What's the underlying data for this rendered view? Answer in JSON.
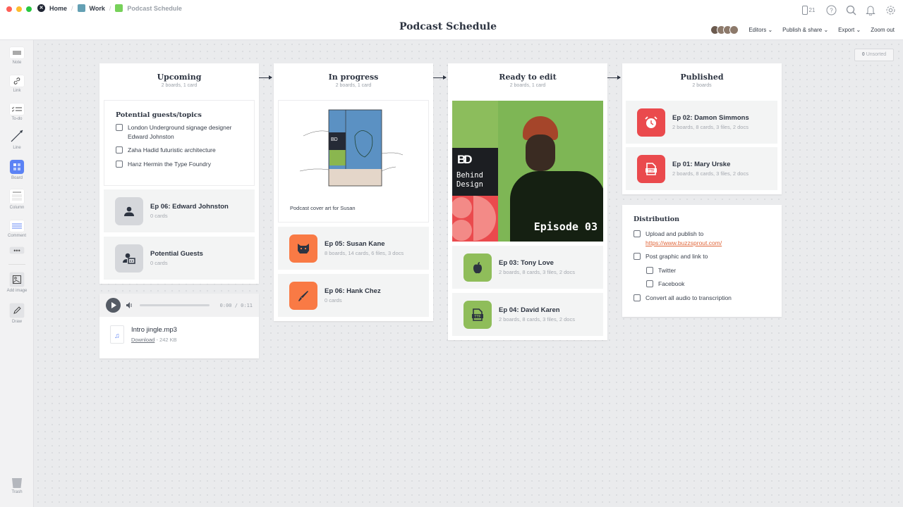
{
  "breadcrumb": {
    "home": "Home",
    "work": "Work",
    "current": "Podcast Schedule",
    "colors": {
      "work": "#64a0b4",
      "current": "#77d15a"
    }
  },
  "page_title": "Podcast Schedule",
  "top_icons": {
    "device_count": "21"
  },
  "menus": {
    "editors": "Editors",
    "publish": "Publish & share",
    "export": "Export",
    "zoom": "Zoom out"
  },
  "unsorted": {
    "count": "0",
    "label": "Unsorted"
  },
  "sidebar": {
    "tools": [
      "Note",
      "Link",
      "To-do",
      "Line",
      "Board",
      "Column",
      "Comment",
      "Add image",
      "Draw"
    ],
    "trash": "Trash"
  },
  "columns": [
    {
      "title": "Upcoming",
      "subtitle": "2 boards, 1 card"
    },
    {
      "title": "In progress",
      "subtitle": "2 boards, 1 card"
    },
    {
      "title": "Ready to edit",
      "subtitle": "2 boards, 1 card"
    },
    {
      "title": "Published",
      "subtitle": "2 boards"
    }
  ],
  "guests_note": {
    "title": "Potential guests/topics",
    "items": [
      "London Underground signage designer Edward Johnston",
      "Zaha Hadid futuristic architecture",
      "Hanz Hermin the Type Foundry"
    ]
  },
  "boards": {
    "edward": {
      "name": "Ep 06: Edward Johnston",
      "sub": "0 cards"
    },
    "guests": {
      "name": "Potential Guests",
      "sub": "0 cards"
    },
    "susan": {
      "name": "Ep 05: Susan Kane",
      "sub": "8 boards, 14 cards, 6 files, 3 docs"
    },
    "hank": {
      "name": "Ep 06: Hank Chez",
      "sub": "0 cards"
    },
    "tony": {
      "name": "Ep 03: Tony Love",
      "sub": "2 boards, 8 cards, 3 files, 2 docs"
    },
    "david": {
      "name": "Ep 04: David Karen",
      "sub": "2 boards, 8 cards, 3 files, 2 docs"
    },
    "damon": {
      "name": "Ep 02: Damon Simmons",
      "sub": "2 boards, 8 cards, 3 files, 2 docs"
    },
    "mary": {
      "name": "Ep 01: Mary Urske",
      "sub": "2 boards, 8 cards, 3 files, 2 docs"
    }
  },
  "audio": {
    "time": "0:00 / 0:11",
    "progress": 0,
    "filename": "Intro jingle.mp3",
    "download": "Download",
    "size": "- 242 KB"
  },
  "sketch": {
    "caption": "Podcast cover art for Susan"
  },
  "cover": {
    "brand_line1": "Behind",
    "brand_line2": "Design",
    "episode": "Episode 03"
  },
  "distribution": {
    "title": "Distribution",
    "items": [
      {
        "text": "Upload and publish to",
        "link": "https://www.buzzsprout.com/"
      },
      {
        "text": "Post graphic and link to"
      },
      {
        "text": "Twitter",
        "indent": true
      },
      {
        "text": "Facebook",
        "indent": true
      },
      {
        "text": "Convert all audio to transcription"
      }
    ]
  },
  "colors": {
    "orange": "#f97a45",
    "green": "#8fbd5a",
    "red": "#ea4a4d",
    "gray": "#d5d7db",
    "accent": "#5b82f5"
  }
}
